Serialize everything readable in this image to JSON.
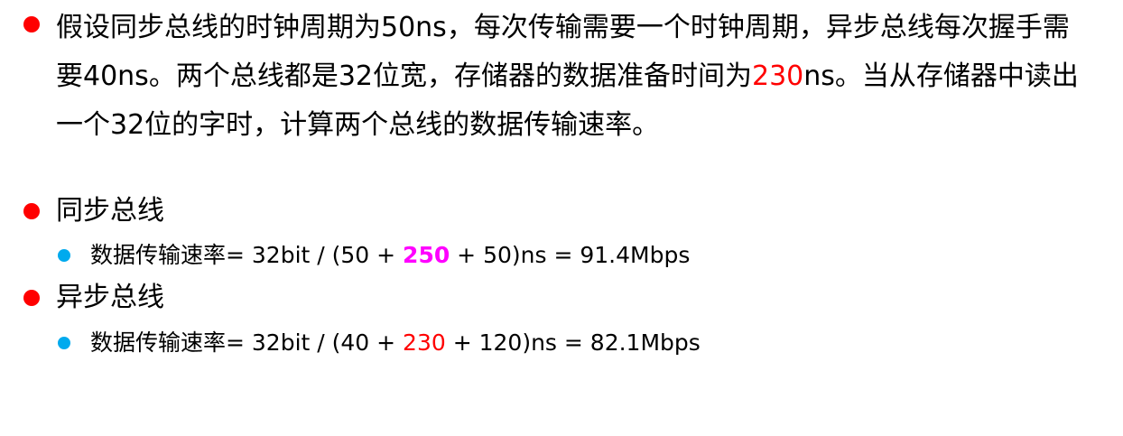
{
  "problem": {
    "text_before": "假设同步总线的时钟周期为50ns，每次传输需要一个时钟周期，异步总线每次握手需要40ns。两个总线都是32位宽，存储器的数据准备时间为",
    "highlight": "230",
    "text_after": "ns。当从存储器中读出一个32位的字时，计算两个总线的数据传输速率。"
  },
  "sync": {
    "heading": "同步总线",
    "formula_prefix": "数据传输速率= 32bit / (50 + ",
    "formula_highlight": "250",
    "formula_suffix": " + 50)ns = 91.4Mbps"
  },
  "async": {
    "heading": "异步总线",
    "formula_prefix": "数据传输速率= 32bit / (40 + ",
    "formula_highlight": "230",
    "formula_suffix": " + 120)ns = 82.1Mbps"
  },
  "colors": {
    "bullet_level1": "#ff0000",
    "bullet_level2": "#00aaee",
    "highlight_red": "#ff0000",
    "highlight_magenta": "#ff00ff"
  }
}
